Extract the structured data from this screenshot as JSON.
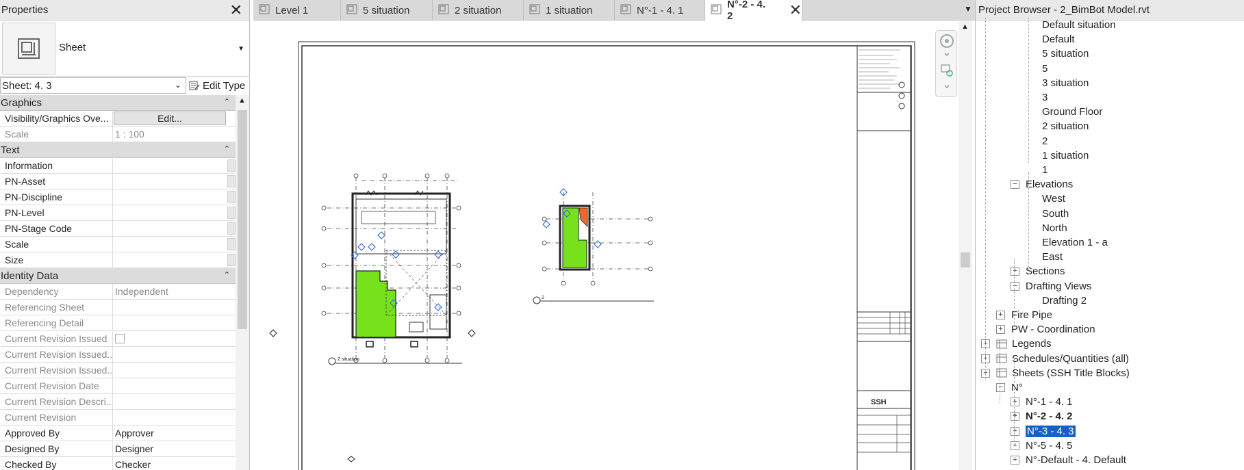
{
  "properties": {
    "title": "Properties",
    "type_name": "Sheet",
    "instance": "Sheet: 4. 3",
    "edit_type": "Edit Type",
    "groups": [
      {
        "name": "Graphics",
        "rows": [
          {
            "key": "Visibility/Graphics Ove...",
            "value": "Edit...",
            "kind": "button"
          },
          {
            "key": "Scale",
            "value": "1 : 100",
            "ro": true
          }
        ]
      },
      {
        "name": "Text",
        "rows": [
          {
            "key": "Information",
            "value": "",
            "kind": "text"
          },
          {
            "key": "PN-Asset",
            "value": "",
            "kind": "text"
          },
          {
            "key": "PN-Discipline",
            "value": "",
            "kind": "text"
          },
          {
            "key": "PN-Level",
            "value": "",
            "kind": "text"
          },
          {
            "key": "PN-Stage Code",
            "value": "",
            "kind": "text"
          },
          {
            "key": "Scale",
            "value": "",
            "kind": "text"
          },
          {
            "key": "Size",
            "value": "",
            "kind": "text"
          }
        ]
      },
      {
        "name": "Identity Data",
        "rows": [
          {
            "key": "Dependency",
            "value": "Independent",
            "ro": true
          },
          {
            "key": "Referencing Sheet",
            "value": "",
            "ro": true
          },
          {
            "key": "Referencing Detail",
            "value": "",
            "ro": true
          },
          {
            "key": "Current Revision Issued",
            "value": "",
            "ro": true,
            "kind": "checkbox"
          },
          {
            "key": "Current Revision Issued...",
            "value": "",
            "ro": true
          },
          {
            "key": "Current Revision Issued...",
            "value": "",
            "ro": true
          },
          {
            "key": "Current Revision Date",
            "value": "",
            "ro": true
          },
          {
            "key": "Current Revision Descri...",
            "value": "",
            "ro": true
          },
          {
            "key": "Current Revision",
            "value": "",
            "ro": true
          },
          {
            "key": "Approved By",
            "value": "Approver"
          },
          {
            "key": "Designed By",
            "value": "Designer"
          },
          {
            "key": "Checked By",
            "value": "Checker"
          }
        ]
      }
    ]
  },
  "tabs": [
    {
      "label": "Level 1",
      "icon": "floor-plan-icon",
      "active": false
    },
    {
      "label": "5 situation",
      "icon": "floor-plan-icon",
      "active": false
    },
    {
      "label": "2 situation",
      "icon": "floor-plan-icon",
      "active": false
    },
    {
      "label": "1 situation",
      "icon": "floor-plan-icon",
      "active": false
    },
    {
      "label": "N°-1 - 4. 1",
      "icon": "sheet-icon",
      "active": false
    },
    {
      "label": "N°-2 - 4. 2",
      "icon": "sheet-icon",
      "active": true
    }
  ],
  "sheet": {
    "view1_label": "2 situation",
    "view2_label": "2",
    "logo": "SSH"
  },
  "browser": {
    "title": "Project Browser - 2_BimBot Model.rvt",
    "nodes": [
      {
        "label": "Default situation",
        "level": 4
      },
      {
        "label": "Default",
        "level": 4
      },
      {
        "label": "5 situation",
        "level": 4
      },
      {
        "label": "5",
        "level": 4
      },
      {
        "label": "3 situation",
        "level": 4
      },
      {
        "label": "3",
        "level": 4
      },
      {
        "label": "Ground Floor",
        "level": 4
      },
      {
        "label": "2 situation",
        "level": 4
      },
      {
        "label": "2",
        "level": 4
      },
      {
        "label": "1 situation",
        "level": 4
      },
      {
        "label": "1",
        "level": 4
      },
      {
        "label": "Elevations",
        "level": 3,
        "exp": "−"
      },
      {
        "label": "West",
        "level": 4
      },
      {
        "label": "South",
        "level": 4
      },
      {
        "label": "North",
        "level": 4
      },
      {
        "label": "Elevation 1 - a",
        "level": 4
      },
      {
        "label": "East",
        "level": 4
      },
      {
        "label": "Sections",
        "level": 3,
        "exp": "+"
      },
      {
        "label": "Drafting Views",
        "level": 3,
        "exp": "−"
      },
      {
        "label": "Drafting 2",
        "level": 4
      },
      {
        "label": "Fire Pipe",
        "level": 2,
        "exp": "+"
      },
      {
        "label": "PW - Coordination",
        "level": 2,
        "exp": "+"
      },
      {
        "label": "Legends",
        "level": 1,
        "exp": "+",
        "icon": "legends-icon"
      },
      {
        "label": "Schedules/Quantities (all)",
        "level": 1,
        "exp": "+",
        "icon": "schedules-icon"
      },
      {
        "label": "Sheets (SSH Title Blocks)",
        "level": 1,
        "exp": "−",
        "icon": "sheets-icon"
      },
      {
        "label": "N°",
        "level": 2,
        "exp": "−"
      },
      {
        "label": "N°-1 - 4. 1",
        "level": 3,
        "exp": "+"
      },
      {
        "label": "N°-2 - 4. 2",
        "level": 3,
        "exp": "+",
        "bold": true
      },
      {
        "label": "N°-3 - 4. 3",
        "level": 3,
        "exp": "+",
        "selected": true
      },
      {
        "label": "N°-5 - 4. 5",
        "level": 3,
        "exp": "+"
      },
      {
        "label": "N°-Default - 4. Default",
        "level": 3,
        "exp": "+"
      }
    ]
  },
  "colors": {
    "selection": "#1660cc",
    "room_fill": "#77e21c",
    "room_accent": "#ee6a2a",
    "grid_bubble": "#3a6fd8"
  }
}
